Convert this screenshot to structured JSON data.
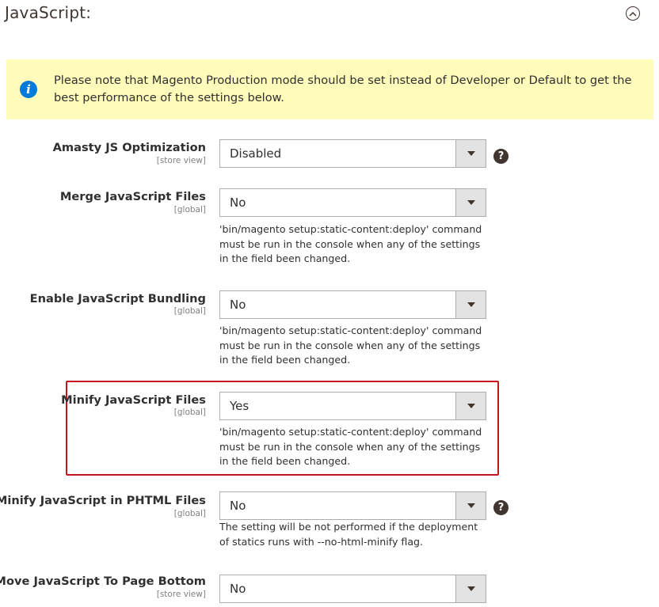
{
  "section": {
    "title": "JavaScript:",
    "collapse_icon": "chevron-up-circle-icon"
  },
  "notice": {
    "icon": "info-icon",
    "text": "Please note that Magento Production mode should be set instead of Developer or Default to get the best performance of the settings below."
  },
  "help_glyph": "?",
  "fields": [
    {
      "label": "Amasty JS Optimization",
      "scope": "[store view]",
      "value": "Disabled",
      "note": "",
      "has_help": true
    },
    {
      "label": "Merge JavaScript Files",
      "scope": "[global]",
      "value": "No",
      "note": "'bin/magento setup:static-content:deploy' command must be run in the console when any of the settings in the field been changed.",
      "has_help": false
    },
    {
      "label": "Enable JavaScript Bundling",
      "scope": "[global]",
      "value": "No",
      "note": "'bin/magento setup:static-content:deploy' command must be run in the console when any of the settings in the field been changed.",
      "has_help": false
    },
    {
      "label": "Minify JavaScript Files",
      "scope": "[global]",
      "value": "Yes",
      "note": "'bin/magento setup:static-content:deploy' command must be run in the console when any of the settings in the field been changed.",
      "has_help": false,
      "highlighted": true
    },
    {
      "label": "Minify JavaScript in PHTML Files",
      "scope": "[global]",
      "value": "No",
      "note": "The setting will be not performed if the deployment of statics runs with --no-html-minify flag.",
      "has_help": true
    },
    {
      "label": "Move JavaScript To Page Bottom",
      "scope": "[store view]",
      "value": "No",
      "note": "",
      "has_help": false
    }
  ],
  "colors": {
    "highlight_border": "#c4161c",
    "notice_bg": "#fffbbb",
    "info_icon": "#007bdb"
  }
}
